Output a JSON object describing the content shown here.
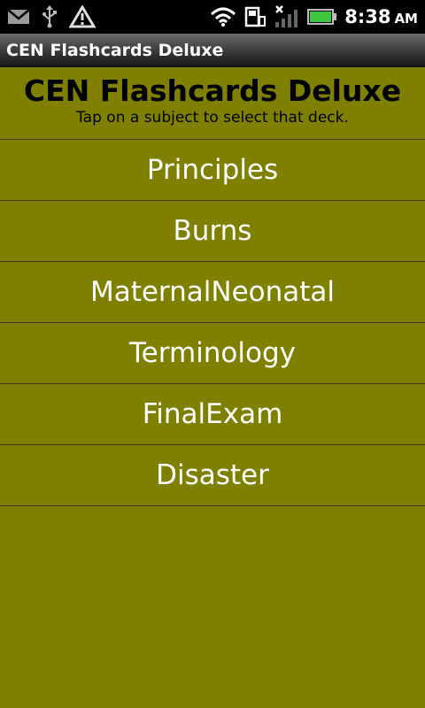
{
  "status_bar": {
    "time": "8:38",
    "ampm": "AM",
    "icons": [
      "gmail-icon",
      "usb-icon",
      "warning-icon",
      "wifi-icon",
      "sd-card-icon",
      "signal-icon",
      "battery-icon"
    ],
    "battery_color": "#3ec43e"
  },
  "app": {
    "title": "CEN Flashcards Deluxe"
  },
  "header": {
    "title": "CEN Flashcards Deluxe",
    "subtitle": "Tap on a subject to select that deck."
  },
  "decks": [
    {
      "label": "Principles"
    },
    {
      "label": "Burns"
    },
    {
      "label": "MaternalNeonatal"
    },
    {
      "label": "Terminology"
    },
    {
      "label": "FinalExam"
    },
    {
      "label": "Disaster"
    }
  ],
  "colors": {
    "background": "#808000",
    "text_primary": "#000000",
    "text_items": "#ffffff"
  }
}
